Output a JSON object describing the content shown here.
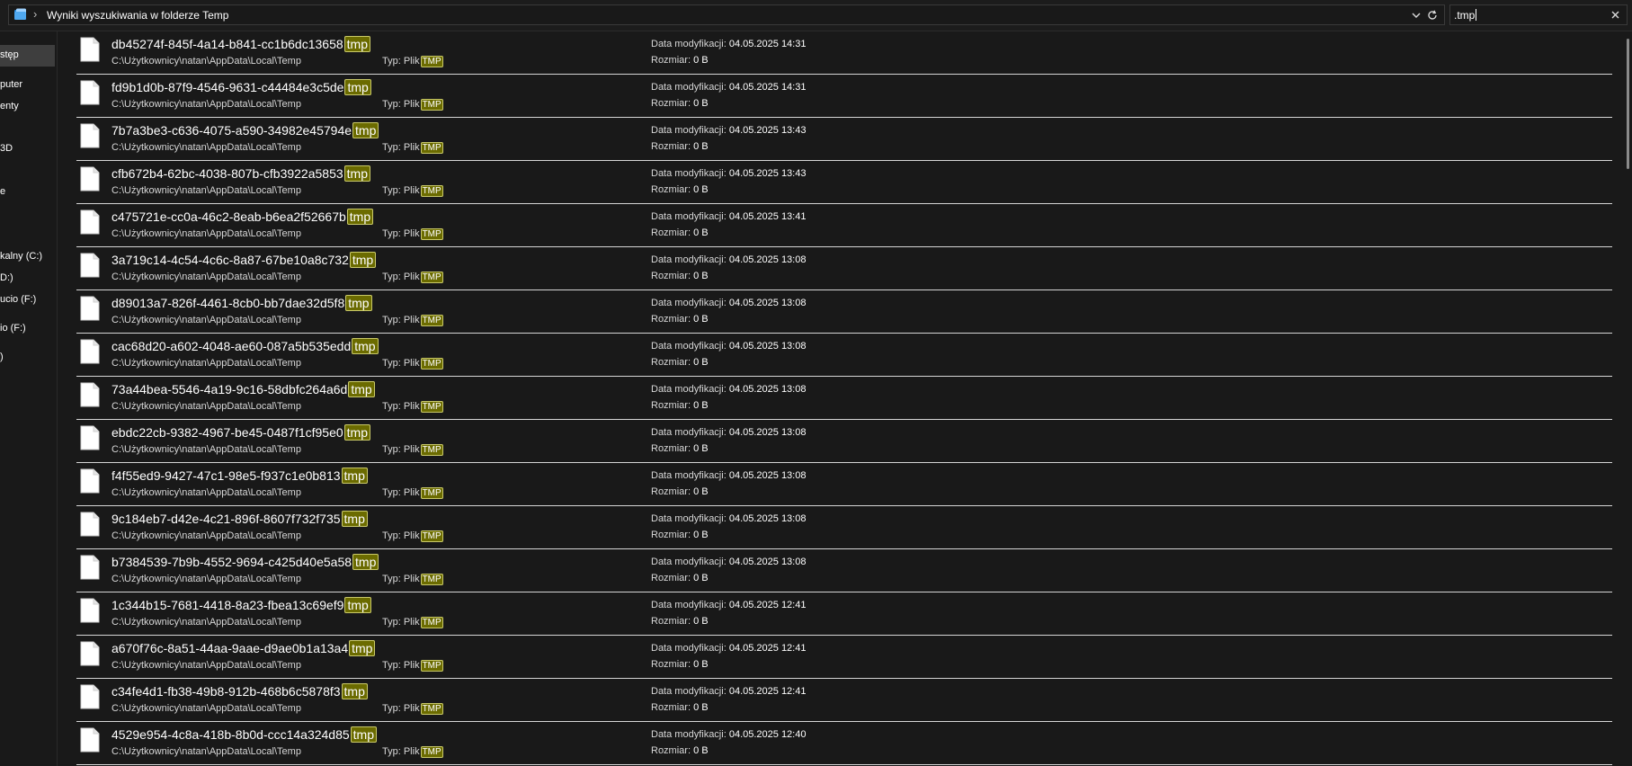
{
  "address_bar": {
    "folder_icon": "folder-icon",
    "path_text": "Wyniki wyszukiwania w folderze Temp",
    "dropdown_icon": "chevron-down-icon",
    "refresh_icon": "refresh-icon"
  },
  "search": {
    "value": ".tmp",
    "clear_icon": "close-icon"
  },
  "sidebar": {
    "items": [
      {
        "label": "stęp",
        "selected": true
      },
      {
        "label": "puter"
      },
      {
        "label": "enty"
      },
      {
        "label": "3D"
      },
      {
        "label": "e"
      },
      {
        "label": "kalny (C:)"
      },
      {
        "label": "D:)"
      },
      {
        "label": "ucio (F:)"
      },
      {
        "label": "io (F:)"
      },
      {
        "label": ")"
      }
    ]
  },
  "labels": {
    "type_label": "Typ: Plik",
    "type_highlight": "TMP",
    "modified_label": "Data modyfikacji:",
    "size_label": "Rozmiar:",
    "name_highlight": "tmp"
  },
  "results": [
    {
      "name": "db45274f-845f-4a14-b841-cc1b6dc13658",
      "path": "C:\\Użytkownicy\\natan\\AppData\\Local\\Temp",
      "modified": "04.05.2025 14:31",
      "size": "0 B"
    },
    {
      "name": "fd9b1d0b-87f9-4546-9631-c44484e3c5de",
      "path": "C:\\Użytkownicy\\natan\\AppData\\Local\\Temp",
      "modified": "04.05.2025 14:31",
      "size": "0 B"
    },
    {
      "name": "7b7a3be3-c636-4075-a590-34982e45794e",
      "path": "C:\\Użytkownicy\\natan\\AppData\\Local\\Temp",
      "modified": "04.05.2025 13:43",
      "size": "0 B"
    },
    {
      "name": "cfb672b4-62bc-4038-807b-cfb3922a5853",
      "path": "C:\\Użytkownicy\\natan\\AppData\\Local\\Temp",
      "modified": "04.05.2025 13:43",
      "size": "0 B"
    },
    {
      "name": "c475721e-cc0a-46c2-8eab-b6ea2f52667b",
      "path": "C:\\Użytkownicy\\natan\\AppData\\Local\\Temp",
      "modified": "04.05.2025 13:41",
      "size": "0 B"
    },
    {
      "name": "3a719c14-4c54-4c6c-8a87-67be10a8c732",
      "path": "C:\\Użytkownicy\\natan\\AppData\\Local\\Temp",
      "modified": "04.05.2025 13:08",
      "size": "0 B"
    },
    {
      "name": "d89013a7-826f-4461-8cb0-bb7dae32d5f8",
      "path": "C:\\Użytkownicy\\natan\\AppData\\Local\\Temp",
      "modified": "04.05.2025 13:08",
      "size": "0 B"
    },
    {
      "name": "cac68d20-a602-4048-ae60-087a5b535edd",
      "path": "C:\\Użytkownicy\\natan\\AppData\\Local\\Temp",
      "modified": "04.05.2025 13:08",
      "size": "0 B"
    },
    {
      "name": "73a44bea-5546-4a19-9c16-58dbfc264a6d",
      "path": "C:\\Użytkownicy\\natan\\AppData\\Local\\Temp",
      "modified": "04.05.2025 13:08",
      "size": "0 B"
    },
    {
      "name": "ebdc22cb-9382-4967-be45-0487f1cf95e0",
      "path": "C:\\Użytkownicy\\natan\\AppData\\Local\\Temp",
      "modified": "04.05.2025 13:08",
      "size": "0 B"
    },
    {
      "name": "f4f55ed9-9427-47c1-98e5-f937c1e0b813",
      "path": "C:\\Użytkownicy\\natan\\AppData\\Local\\Temp",
      "modified": "04.05.2025 13:08",
      "size": "0 B"
    },
    {
      "name": "9c184eb7-d42e-4c21-896f-8607f732f735",
      "path": "C:\\Użytkownicy\\natan\\AppData\\Local\\Temp",
      "modified": "04.05.2025 13:08",
      "size": "0 B"
    },
    {
      "name": "b7384539-7b9b-4552-9694-c425d40e5a58",
      "path": "C:\\Użytkownicy\\natan\\AppData\\Local\\Temp",
      "modified": "04.05.2025 13:08",
      "size": "0 B"
    },
    {
      "name": "1c344b15-7681-4418-8a23-fbea13c69ef9",
      "path": "C:\\Użytkownicy\\natan\\AppData\\Local\\Temp",
      "modified": "04.05.2025 12:41",
      "size": "0 B"
    },
    {
      "name": "a670f76c-8a51-44aa-9aae-d9ae0b1a13a4",
      "path": "C:\\Użytkownicy\\natan\\AppData\\Local\\Temp",
      "modified": "04.05.2025 12:41",
      "size": "0 B"
    },
    {
      "name": "c34fe4d1-fb38-49b8-912b-468b6c5878f3",
      "path": "C:\\Użytkownicy\\natan\\AppData\\Local\\Temp",
      "modified": "04.05.2025 12:41",
      "size": "0 B"
    },
    {
      "name": "4529e954-4c8a-418b-8b0d-ccc14a324d85",
      "path": "C:\\Użytkownicy\\natan\\AppData\\Local\\Temp",
      "modified": "04.05.2025 12:40",
      "size": "0 B"
    }
  ],
  "colors": {
    "background": "#191919",
    "highlight_fill": "#6b6b00",
    "highlight_border": "#c9c96a",
    "row_divider": "#d6d6d6"
  }
}
